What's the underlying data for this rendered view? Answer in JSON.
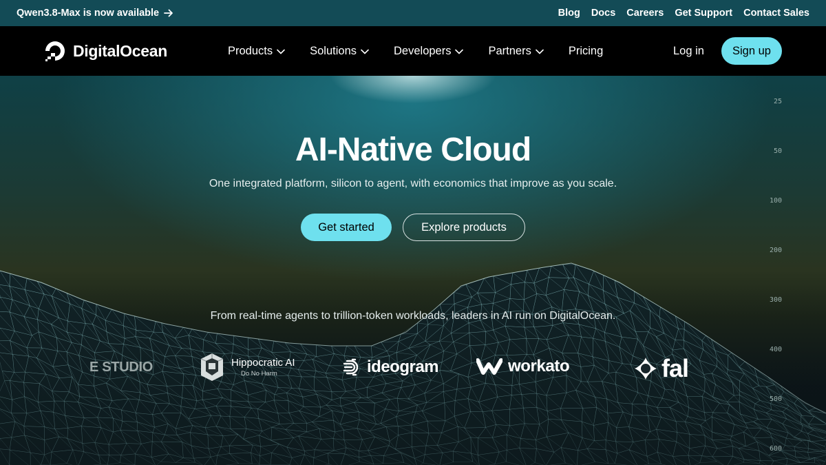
{
  "announcement": {
    "promo_text": "Qwen3.8-Max is now available",
    "links": [
      "Blog",
      "Docs",
      "Careers",
      "Get Support",
      "Contact Sales"
    ]
  },
  "nav": {
    "brand": "DigitalOcean",
    "menu": [
      {
        "label": "Products",
        "dropdown": true
      },
      {
        "label": "Solutions",
        "dropdown": true
      },
      {
        "label": "Developers",
        "dropdown": true
      },
      {
        "label": "Partners",
        "dropdown": true
      },
      {
        "label": "Pricing",
        "dropdown": false
      }
    ],
    "login": "Log in",
    "signup": "Sign up"
  },
  "hero": {
    "title": "AI-Native Cloud",
    "subtitle": "One integrated platform, silicon to agent, with economics that improve as you scale.",
    "primary_cta": "Get started",
    "secondary_cta": "Explore products",
    "leaders_text": "From real-time agents to trillion-token workloads, leaders in AI run on DigitalOcean.",
    "ruler_ticks": [
      "25",
      "50",
      "100",
      "200",
      "300",
      "400",
      "500",
      "600"
    ]
  },
  "customers": {
    "studio": "E STUDIO",
    "hippocratic": "Hippocratic AI",
    "hippocratic_tagline": "Do No Harm",
    "ideogram": "ideogram",
    "workato": "workato",
    "fal": "fal"
  },
  "colors": {
    "accent": "#6ee0ee",
    "announcement_bg": "#134b56",
    "nav_bg": "#000000"
  },
  "icons": {
    "promo_arrow": "arrow-right-icon",
    "dropdown": "chevron-down-icon",
    "logo": "digitalocean-logo-icon"
  }
}
